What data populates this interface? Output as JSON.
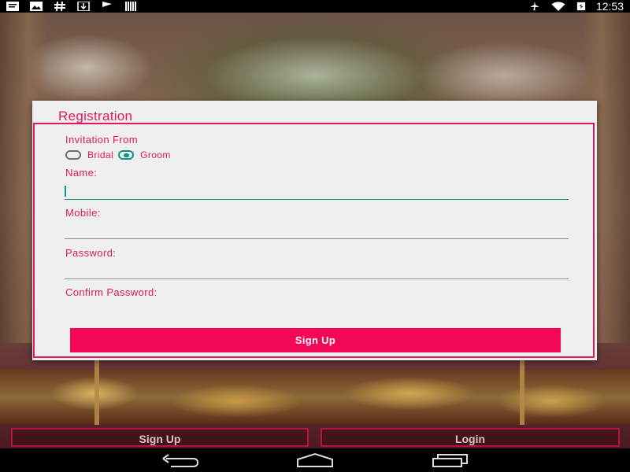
{
  "status_bar": {
    "left_icons": [
      "message-icon",
      "image-icon",
      "hashtag-icon",
      "download-icon",
      "flag-icon",
      "barcode-icon"
    ],
    "right_icons": [
      "airplane-mode-icon",
      "wifi-icon",
      "battery-icon"
    ],
    "time": "12:53"
  },
  "dialog": {
    "title": "Registration",
    "invitation_label": "Invitation From",
    "radio_options": [
      {
        "label": "Bridal",
        "checked": false
      },
      {
        "label": "Groom",
        "checked": true
      }
    ],
    "fields": [
      {
        "label": "Name:",
        "value": "",
        "focused": true
      },
      {
        "label": "Mobile:",
        "value": ""
      },
      {
        "label": "Password:",
        "value": ""
      },
      {
        "label": "Confirm Password:",
        "value": ""
      }
    ],
    "submit_label": "Sign Up"
  },
  "bottom_buttons": {
    "signup_label": "Sign Up",
    "login_label": "Login"
  },
  "nav_bar": {
    "icons": [
      "back-icon",
      "home-icon",
      "recent-apps-icon"
    ]
  },
  "colors": {
    "accent": "#e2185b",
    "button": "#f50757",
    "focus": "#0a9485"
  }
}
